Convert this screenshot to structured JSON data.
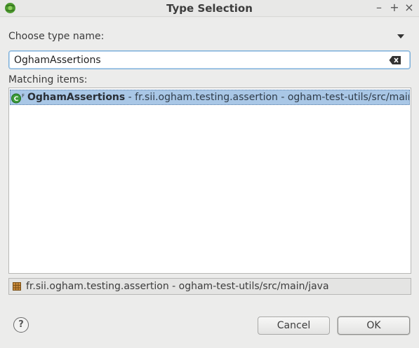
{
  "window": {
    "title": "Type Selection",
    "controls": [
      "–",
      "+",
      "×"
    ]
  },
  "filter": {
    "label": "Choose type name:",
    "value": "OghamAssertions"
  },
  "matching": {
    "label": "Matching items:",
    "items": [
      {
        "name": "OghamAssertions",
        "detail": " - fr.sii.ogham.testing.assertion - ogham-test-utils/src/main/ja",
        "icon": "public-class-final-icon",
        "selected": true
      }
    ]
  },
  "status": {
    "text": "fr.sii.ogham.testing.assertion - ogham-test-utils/src/main/java",
    "icon": "package-icon"
  },
  "buttons": {
    "help": "?",
    "cancel": "Cancel",
    "ok": "OK"
  },
  "colors": {
    "selection": "#a9c7e6",
    "focus_border": "#7bafd9",
    "class_icon": "#3d9c3a"
  }
}
